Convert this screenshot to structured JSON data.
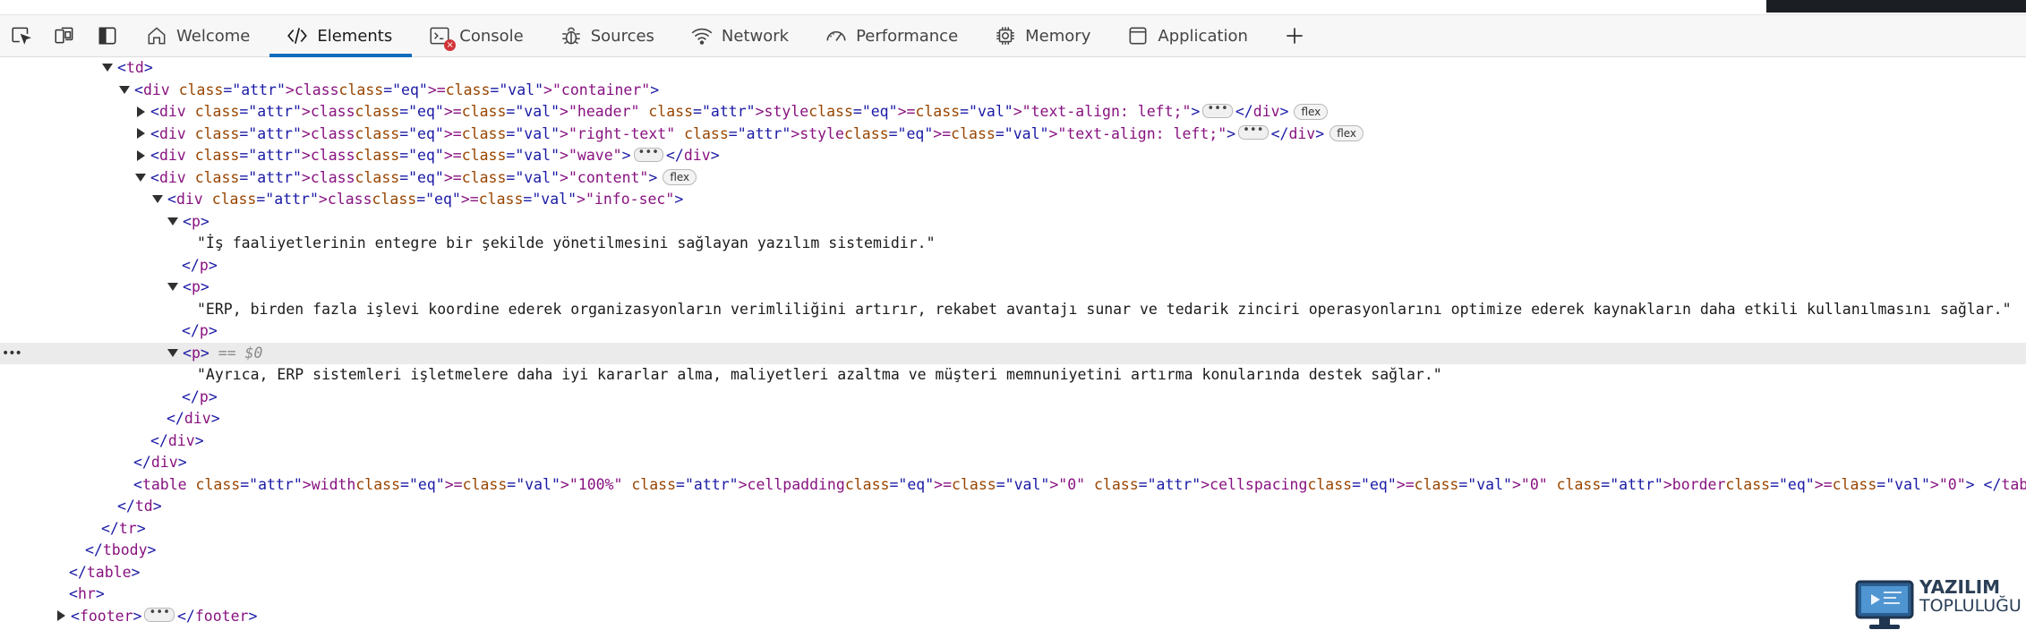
{
  "toolbar": {
    "tools": [
      {
        "icon": "inspect-element-icon"
      },
      {
        "icon": "device-emulation-icon"
      },
      {
        "icon": "toggle-sidebar-icon"
      }
    ],
    "tabs": [
      {
        "label": "Welcome",
        "icon": "home-icon"
      },
      {
        "label": "Elements",
        "icon": "code-brackets-icon",
        "active": true
      },
      {
        "label": "Console",
        "icon": "console-icon",
        "badge": "×"
      },
      {
        "label": "Sources",
        "icon": "bug-icon"
      },
      {
        "label": "Network",
        "icon": "wifi-icon"
      },
      {
        "label": "Performance",
        "icon": "gauge-icon"
      },
      {
        "label": "Memory",
        "icon": "chip-icon"
      },
      {
        "label": "Application",
        "icon": "window-icon"
      }
    ],
    "add_tab": "+"
  },
  "dom": {
    "lines": [
      {
        "t": "<td>"
      },
      {
        "t": "<div class=\"container\">"
      },
      {
        "t": "<div class=\"header\" style=\"text-align: left;\">",
        "tail": "</div>",
        "badge": "flex"
      },
      {
        "t": "<div class=\"right-text\" style=\"text-align: left;\">",
        "tail": "</div>",
        "badge": "flex"
      },
      {
        "t": "<div class=\"wave\">",
        "tail": "</div>"
      },
      {
        "t": "<div class=\"content\">",
        "badge": "flex"
      },
      {
        "t": "<div class=\"info-sec\">"
      },
      {
        "t": "<p>"
      },
      {
        "t": "\"İş faaliyetlerinin entegre bir şekilde yönetilmesini sağlayan yazılım sistemidir.\""
      },
      {
        "t": "</p>"
      },
      {
        "t": "<p>"
      },
      {
        "t": "\"ERP, birden fazla işlevi koordine ederek organizasyonların verimliliğini artırır, rekabet avantajı sunar ve tedarik zinciri operasyonlarını optimize ederek kaynakların daha etkili kullanılmasını sağlar.\""
      },
      {
        "t": "</p>"
      },
      {
        "t": "<p>",
        "tail": "== $0"
      },
      {
        "t": "\"Ayrıca, ERP sistemleri işletmelere daha iyi kararlar alma, maliyetleri azaltma ve müşteri memnuniyetini artırma konularında destek sağlar.\""
      },
      {
        "t": "</p>"
      },
      {
        "t": "</div>"
      },
      {
        "t": "</div>"
      },
      {
        "t": "</div>"
      },
      {
        "t": "<table width=\"100%\" cellpadding=\"0\" cellspacing=\"0\" border=\"0\">",
        "tail": "</table>"
      },
      {
        "t": "</td>"
      },
      {
        "t": "</tr>"
      },
      {
        "t": "</tbody>"
      },
      {
        "t": "</table>"
      },
      {
        "t": "<hr>"
      },
      {
        "t": "<footer>",
        "tail": "</footer>"
      }
    ],
    "ellipsis": "•••",
    "gutter": "•••"
  },
  "logo": {
    "line1": "YAZILIM",
    "line2": "TOPLULUĞU"
  },
  "colors": {
    "accent": "#0f6cbd",
    "tag": "#881280",
    "attr_name": "#994500",
    "attr_value": "#1a1aa6",
    "error": "#d13438"
  }
}
